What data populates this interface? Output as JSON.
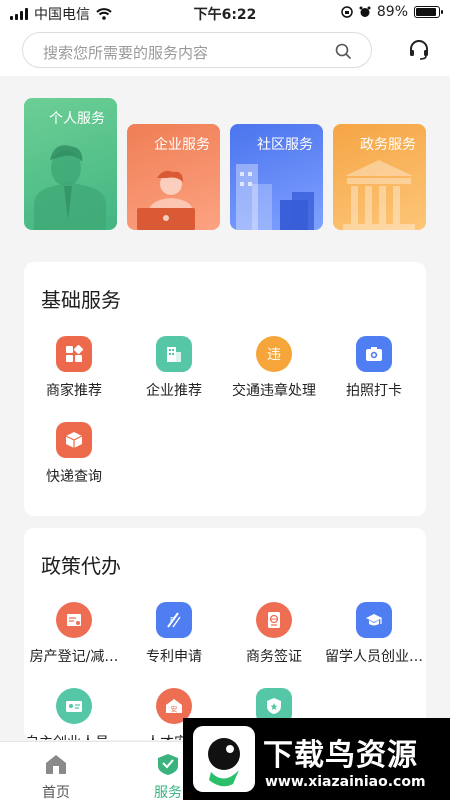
{
  "status_bar": {
    "carrier": "中国电信",
    "time": "下午6:22",
    "battery_percent": "89%",
    "battery_level": 0.89
  },
  "search": {
    "placeholder": "搜索您所需要的服务内容"
  },
  "categories": [
    {
      "label": "个人服务",
      "color": "#4fbf87"
    },
    {
      "label": "企业服务",
      "color": "#f28a62"
    },
    {
      "label": "社区服务",
      "color": "#5b82f0"
    },
    {
      "label": "政务服务",
      "color": "#f8ae52"
    }
  ],
  "basic_services": {
    "title": "基础服务",
    "items": [
      {
        "label": "商家推荐",
        "icon": "grid-icon",
        "color": "#ec6a4b"
      },
      {
        "label": "企业推荐",
        "icon": "building-icon",
        "color": "#55c7a6"
      },
      {
        "label": "交通违章处理",
        "icon": "violation-icon",
        "color": "#f6a53a"
      },
      {
        "label": "拍照打卡",
        "icon": "camera-icon",
        "color": "#4f7df2"
      },
      {
        "label": "快递查询",
        "icon": "package-icon",
        "color": "#ec6a4b"
      }
    ]
  },
  "policy_services": {
    "title": "政策代办",
    "items": [
      {
        "label": "房产登记/减…",
        "icon": "certificate-icon",
        "color": "#ee6e54"
      },
      {
        "label": "专利申请",
        "icon": "patent-icon",
        "color": "#4f7df2"
      },
      {
        "label": "商务签证",
        "icon": "passport-icon",
        "color": "#ee6e54"
      },
      {
        "label": "留学人员创业…",
        "icon": "graduation-cap-icon",
        "color": "#4f7df2"
      },
      {
        "label": "自主创业人员…",
        "icon": "id-card-icon",
        "color": "#55c7a6"
      },
      {
        "label": "人才安…",
        "icon": "house-icon",
        "color": "#ee6e54"
      },
      {
        "label": "",
        "icon": "shield-icon",
        "color": "#55c7a6"
      }
    ]
  },
  "bottom_nav": [
    {
      "label": "首页",
      "icon": "home-icon",
      "active": false
    },
    {
      "label": "服务",
      "icon": "service-icon",
      "active": true
    }
  ],
  "watermark": {
    "title": "下载鸟资源",
    "url": "www.xiazainiao.com"
  },
  "colors": {
    "accent": "#3bb37f",
    "inactive": "#555555"
  }
}
